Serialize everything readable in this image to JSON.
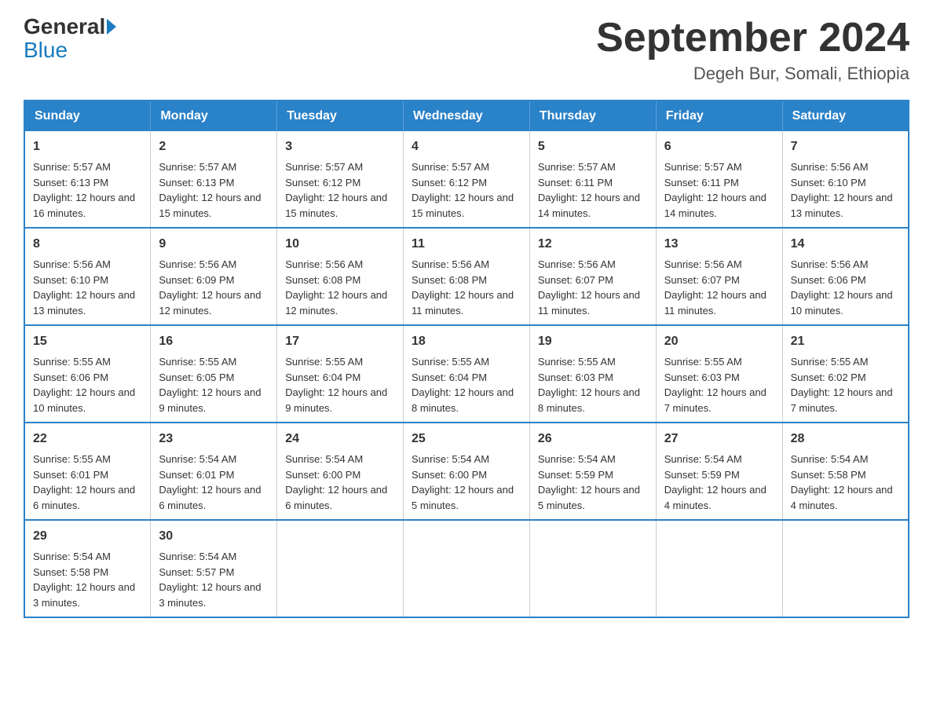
{
  "logo": {
    "general": "General",
    "blue": "Blue",
    "tagline": "Blue"
  },
  "header": {
    "month_year": "September 2024",
    "location": "Degeh Bur, Somali, Ethiopia"
  },
  "weekdays": [
    "Sunday",
    "Monday",
    "Tuesday",
    "Wednesday",
    "Thursday",
    "Friday",
    "Saturday"
  ],
  "weeks": [
    [
      {
        "day": "1",
        "sunrise": "5:57 AM",
        "sunset": "6:13 PM",
        "daylight": "12 hours and 16 minutes."
      },
      {
        "day": "2",
        "sunrise": "5:57 AM",
        "sunset": "6:13 PM",
        "daylight": "12 hours and 15 minutes."
      },
      {
        "day": "3",
        "sunrise": "5:57 AM",
        "sunset": "6:12 PM",
        "daylight": "12 hours and 15 minutes."
      },
      {
        "day": "4",
        "sunrise": "5:57 AM",
        "sunset": "6:12 PM",
        "daylight": "12 hours and 15 minutes."
      },
      {
        "day": "5",
        "sunrise": "5:57 AM",
        "sunset": "6:11 PM",
        "daylight": "12 hours and 14 minutes."
      },
      {
        "day": "6",
        "sunrise": "5:57 AM",
        "sunset": "6:11 PM",
        "daylight": "12 hours and 14 minutes."
      },
      {
        "day": "7",
        "sunrise": "5:56 AM",
        "sunset": "6:10 PM",
        "daylight": "12 hours and 13 minutes."
      }
    ],
    [
      {
        "day": "8",
        "sunrise": "5:56 AM",
        "sunset": "6:10 PM",
        "daylight": "12 hours and 13 minutes."
      },
      {
        "day": "9",
        "sunrise": "5:56 AM",
        "sunset": "6:09 PM",
        "daylight": "12 hours and 12 minutes."
      },
      {
        "day": "10",
        "sunrise": "5:56 AM",
        "sunset": "6:08 PM",
        "daylight": "12 hours and 12 minutes."
      },
      {
        "day": "11",
        "sunrise": "5:56 AM",
        "sunset": "6:08 PM",
        "daylight": "12 hours and 11 minutes."
      },
      {
        "day": "12",
        "sunrise": "5:56 AM",
        "sunset": "6:07 PM",
        "daylight": "12 hours and 11 minutes."
      },
      {
        "day": "13",
        "sunrise": "5:56 AM",
        "sunset": "6:07 PM",
        "daylight": "12 hours and 11 minutes."
      },
      {
        "day": "14",
        "sunrise": "5:56 AM",
        "sunset": "6:06 PM",
        "daylight": "12 hours and 10 minutes."
      }
    ],
    [
      {
        "day": "15",
        "sunrise": "5:55 AM",
        "sunset": "6:06 PM",
        "daylight": "12 hours and 10 minutes."
      },
      {
        "day": "16",
        "sunrise": "5:55 AM",
        "sunset": "6:05 PM",
        "daylight": "12 hours and 9 minutes."
      },
      {
        "day": "17",
        "sunrise": "5:55 AM",
        "sunset": "6:04 PM",
        "daylight": "12 hours and 9 minutes."
      },
      {
        "day": "18",
        "sunrise": "5:55 AM",
        "sunset": "6:04 PM",
        "daylight": "12 hours and 8 minutes."
      },
      {
        "day": "19",
        "sunrise": "5:55 AM",
        "sunset": "6:03 PM",
        "daylight": "12 hours and 8 minutes."
      },
      {
        "day": "20",
        "sunrise": "5:55 AM",
        "sunset": "6:03 PM",
        "daylight": "12 hours and 7 minutes."
      },
      {
        "day": "21",
        "sunrise": "5:55 AM",
        "sunset": "6:02 PM",
        "daylight": "12 hours and 7 minutes."
      }
    ],
    [
      {
        "day": "22",
        "sunrise": "5:55 AM",
        "sunset": "6:01 PM",
        "daylight": "12 hours and 6 minutes."
      },
      {
        "day": "23",
        "sunrise": "5:54 AM",
        "sunset": "6:01 PM",
        "daylight": "12 hours and 6 minutes."
      },
      {
        "day": "24",
        "sunrise": "5:54 AM",
        "sunset": "6:00 PM",
        "daylight": "12 hours and 6 minutes."
      },
      {
        "day": "25",
        "sunrise": "5:54 AM",
        "sunset": "6:00 PM",
        "daylight": "12 hours and 5 minutes."
      },
      {
        "day": "26",
        "sunrise": "5:54 AM",
        "sunset": "5:59 PM",
        "daylight": "12 hours and 5 minutes."
      },
      {
        "day": "27",
        "sunrise": "5:54 AM",
        "sunset": "5:59 PM",
        "daylight": "12 hours and 4 minutes."
      },
      {
        "day": "28",
        "sunrise": "5:54 AM",
        "sunset": "5:58 PM",
        "daylight": "12 hours and 4 minutes."
      }
    ],
    [
      {
        "day": "29",
        "sunrise": "5:54 AM",
        "sunset": "5:58 PM",
        "daylight": "12 hours and 3 minutes."
      },
      {
        "day": "30",
        "sunrise": "5:54 AM",
        "sunset": "5:57 PM",
        "daylight": "12 hours and 3 minutes."
      },
      null,
      null,
      null,
      null,
      null
    ]
  ]
}
